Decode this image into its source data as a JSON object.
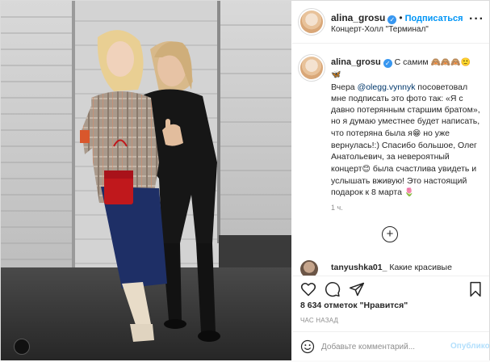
{
  "post": {
    "username": "alina_grosu",
    "verified_mark": "✓",
    "separator": "•",
    "follow_label": "Подписаться",
    "location": "Концерт-Холл \"Терминал\"",
    "more_label": "···"
  },
  "caption": {
    "username": "alina_grosu",
    "verified_mark": "✓",
    "lead": " С самим ",
    "lead_emoji": "🙈🙈🙈🙂 🦋",
    "text_1": "Вчера ",
    "mention": "@olegg.vynnyk",
    "text_2": " посоветовал мне подписать это фото так: «Я с давно потерянным старшим братом», но я думаю уместнее будет написать, что потеряна была я",
    "emoji_1": "😁",
    "text_3": " но уже вернулась!:) Спасибо большое, Олег Анатольевич, за невероятный концерт",
    "emoji_2": "😊",
    "text_4": " была счастлива увидеть и услышать вживую! Это настоящий подарок к 8 марта ",
    "emoji_3": "🌷",
    "time_ago": "1 ч.",
    "load_more": "+"
  },
  "comment_2": {
    "username": "tanyushka01_",
    "text": " Какие красивые"
  },
  "actions": {
    "like_icon": "heart-icon",
    "comment_icon": "comment-icon",
    "share_icon": "share-icon",
    "save_icon": "bookmark-icon"
  },
  "likes": "8 634 отметок \"Нравится\"",
  "posted": "ЧАС НАЗАД",
  "add_comment": {
    "placeholder": "Добавьте комментарий...",
    "publish_label": "Опубликовать"
  },
  "colors": {
    "accent": "#0095f6",
    "verified": "#3897f0",
    "muted": "#8e8e8e",
    "border": "#dbdbdb"
  }
}
